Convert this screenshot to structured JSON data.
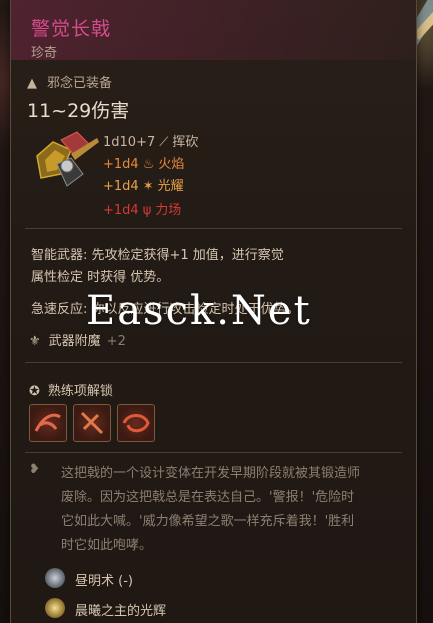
{
  "item": {
    "name": "警觉长戟",
    "rarity": "珍奇",
    "equip_status": "邪念已装备",
    "damage_total": "11~29伤害",
    "damage_lines": [
      {
        "dice": "1d10+7",
        "type": "挥砍",
        "icon": "slash-icon",
        "color": "#c7b59e"
      },
      {
        "dice": "+1d4",
        "type": "火焰",
        "icon": "fire-icon",
        "color": "#e88a3a"
      },
      {
        "dice": "+1d4",
        "type": "光耀",
        "icon": "radiant-icon",
        "color": "#e8a048"
      },
      {
        "dice": "+1d4",
        "type": "力场",
        "icon": "force-icon",
        "color": "#d33a33"
      }
    ],
    "passive_line1": "智能武器: 先攻检定获得+1 加值，进行察觉",
    "passive_line2": "属性检定 时获得 优势。",
    "passive_line3": "急速反应: 你以反应进行攻击检定时处于优势。",
    "enchant_label": "武器附魔",
    "enchant_bonus": "+2",
    "proficiency_label": "熟练项解锁",
    "lore_lines": [
      "这把戟的一个设计变体在开发早期阶段就被其锻造师",
      "废除。因为这把戟总是在表达自己。'警报！'危险时",
      "它如此大喊。'威力像希望之歌一样充斥着我！'胜利",
      "时它如此咆哮。"
    ],
    "spells": [
      {
        "name": "昼明术 (-)",
        "icon": "daylight-icon"
      },
      {
        "name": "晨曦之主的光辉",
        "icon": "dawnmaster-icon"
      }
    ]
  },
  "watermark": "Easck.Net",
  "colors": {
    "name": "#d54c8a",
    "fire": "#e88a3a",
    "radiant": "#e8a048",
    "force": "#d33a33",
    "body_text": "#d6c6b0",
    "lore_text": "#8d7f71"
  }
}
